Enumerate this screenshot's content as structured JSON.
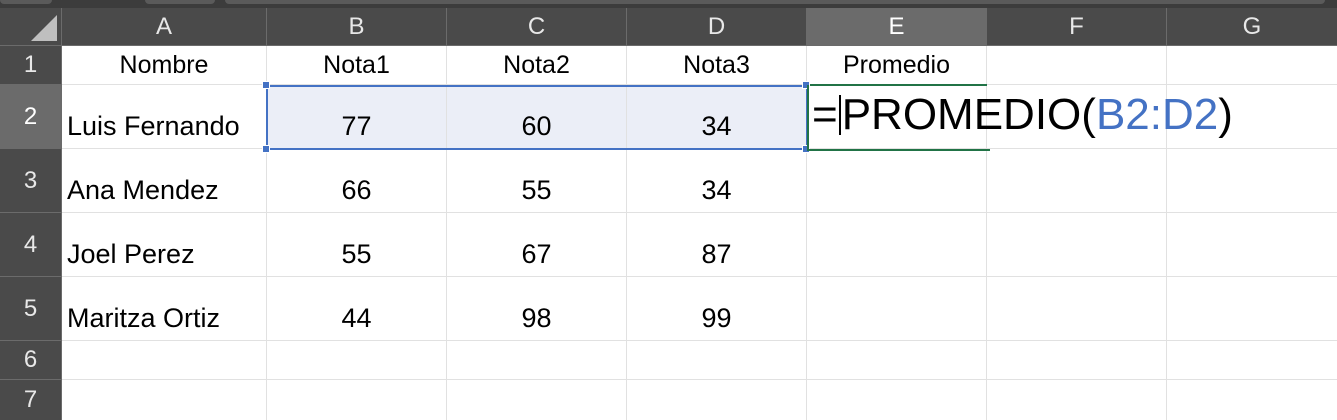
{
  "columns": [
    "A",
    "B",
    "C",
    "D",
    "E",
    "F",
    "G"
  ],
  "rows": [
    "1",
    "2",
    "3",
    "4",
    "5",
    "6",
    "7"
  ],
  "active_column": "E",
  "header_row": {
    "a": "Nombre",
    "b": "Nota1",
    "c": "Nota2",
    "d": "Nota3",
    "e": "Promedio"
  },
  "data_rows": [
    {
      "name": "Luis Fernando",
      "nota1": "77",
      "nota2": "60",
      "nota3": "34"
    },
    {
      "name": "Ana Mendez",
      "nota1": "66",
      "nota2": "55",
      "nota3": "34"
    },
    {
      "name": "Joel Perez",
      "nota1": "55",
      "nota2": "67",
      "nota3": "87"
    },
    {
      "name": "Maritza Ortiz",
      "nota1": "44",
      "nota2": "98",
      "nota3": "99"
    }
  ],
  "formula": {
    "prefix": "=PROMEDIO(",
    "reference": "B2:D2",
    "suffix": ")"
  },
  "selected_range": "B2:D2",
  "colors": {
    "header_bg": "#4a4a4a",
    "active_header_bg": "#6b6b6b",
    "range_border": "#4472c4",
    "range_fill": "#ebeef7",
    "edit_cell_border": "#217346"
  }
}
